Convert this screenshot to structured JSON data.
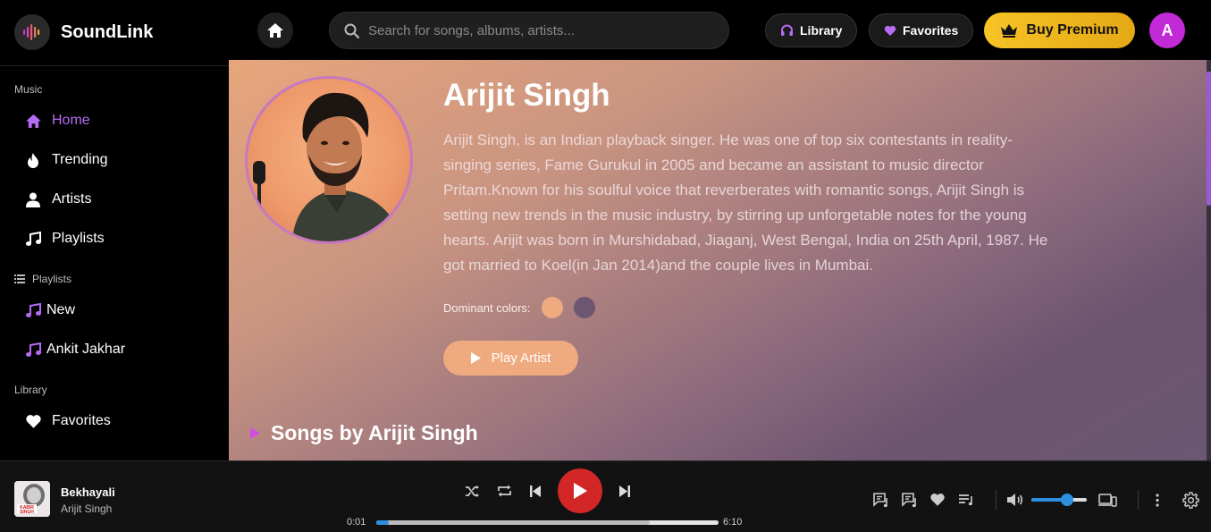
{
  "app": {
    "name": "SoundLink"
  },
  "header": {
    "search_placeholder": "Search for songs, albums, artists...",
    "library_label": "Library",
    "favorites_label": "Favorites",
    "premium_label": "Buy Premium",
    "avatar_initial": "A"
  },
  "sidebar": {
    "music_title": "Music",
    "music_items": [
      {
        "label": "Home",
        "icon": "home-icon",
        "active": true
      },
      {
        "label": "Trending",
        "icon": "fire-icon"
      },
      {
        "label": "Artists",
        "icon": "user-icon"
      },
      {
        "label": "Playlists",
        "icon": "music-note-icon"
      }
    ],
    "playlists_title": "Playlists",
    "playlist_items": [
      {
        "label": "New",
        "icon": "music-note-icon"
      },
      {
        "label": "Ankit Jakhar",
        "icon": "music-note-icon"
      }
    ],
    "library_title": "Library",
    "library_items": [
      {
        "label": "Favorites",
        "icon": "heart-icon"
      }
    ]
  },
  "artist": {
    "name": "Arijit Singh",
    "bio": "Arijit Singh, is an Indian playback singer. He was one of top six contestants in reality-singing series, Fame Gurukul in 2005 and became an assistant to music director Pritam.Known for his soulful voice that reverberates with romantic songs, Arijit Singh is setting new trends in the music industry, by stirring up unforgetable notes for the young hearts. Arijit was born in Murshidabad, Jiaganj, West Bengal, India on 25th April, 1987. He got married to Koel(in Jan 2014)and the couple lives in Mumbai.",
    "dominant_colors_label": "Dominant colors:",
    "dominant_colors": [
      "#eeab7f",
      "#6d5672"
    ],
    "play_label": "Play Artist",
    "songs_heading": "Songs by Arijit Singh"
  },
  "player": {
    "track_title": "Bekhayali",
    "track_artist": "Arijit Singh",
    "cover_text": "KABIR SINGH",
    "elapsed": "0:01",
    "duration": "6:10",
    "progress_fraction": 0.003,
    "buffered_fraction": 0.8,
    "volume_fraction": 0.65
  },
  "colors": {
    "accent": "#b56cf2",
    "play_button": "#d32727",
    "premium": "#f7c325",
    "progress": "#2e8fe0"
  }
}
